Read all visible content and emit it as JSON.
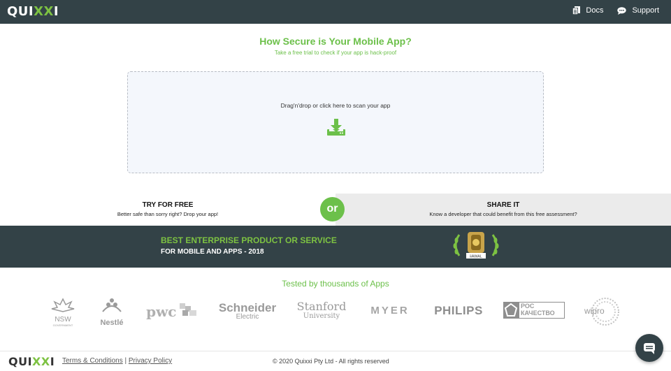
{
  "header": {
    "logo_prefix": "QUI",
    "logo_x": "XX",
    "logo_suffix": "I",
    "nav": [
      {
        "label": "Docs",
        "icon": "docs-icon"
      },
      {
        "label": "Support",
        "icon": "chat-bubble-icon"
      }
    ]
  },
  "hero": {
    "title": "How Secure is Your Mobile App?",
    "subtitle": "Take a free trial to check if your app is hack-proof"
  },
  "dropzone": {
    "text": "Drag'n'drop or click here to scan your app",
    "icon": "download-icon"
  },
  "split": {
    "left_title": "TRY FOR FREE",
    "left_subtitle": "Better safe than sorry right? Drop your app!",
    "or_label": "or",
    "right_title": "SHARE IT",
    "right_subtitle": "Know a developer that could benefit from this free assessment?"
  },
  "award": {
    "line1": "BEST ENTERPRISE PRODUCT OR SERVICE",
    "line2": "FOR MOBILE AND APPS - 2018",
    "badge_label": "iiAWAL"
  },
  "clients": {
    "heading": "Tested by thousands of Apps",
    "logos": [
      {
        "name": "NSW",
        "sub": "GOVERNMENT"
      },
      {
        "name": "Nestlé"
      },
      {
        "name": "pwc"
      },
      {
        "name": "Schneider",
        "sub": "Electric"
      },
      {
        "name": "Stanford",
        "sub": "University"
      },
      {
        "name": "MYER"
      },
      {
        "name": "PHILIPS"
      },
      {
        "name": "РОС",
        "sub": "КАЧЕСТВО"
      },
      {
        "name": "wipro"
      }
    ]
  },
  "footer": {
    "logo_prefix": "QUI",
    "logo_x": "XX",
    "logo_suffix": "I",
    "terms": "Terms & Conditions",
    "separator": "|",
    "privacy": "Privacy Policy",
    "copyright": "© 2020 Quixxi Pty Ltd - All rights reserved"
  },
  "colors": {
    "brand_dark": "#334247",
    "brand_green": "#6cc04a"
  }
}
